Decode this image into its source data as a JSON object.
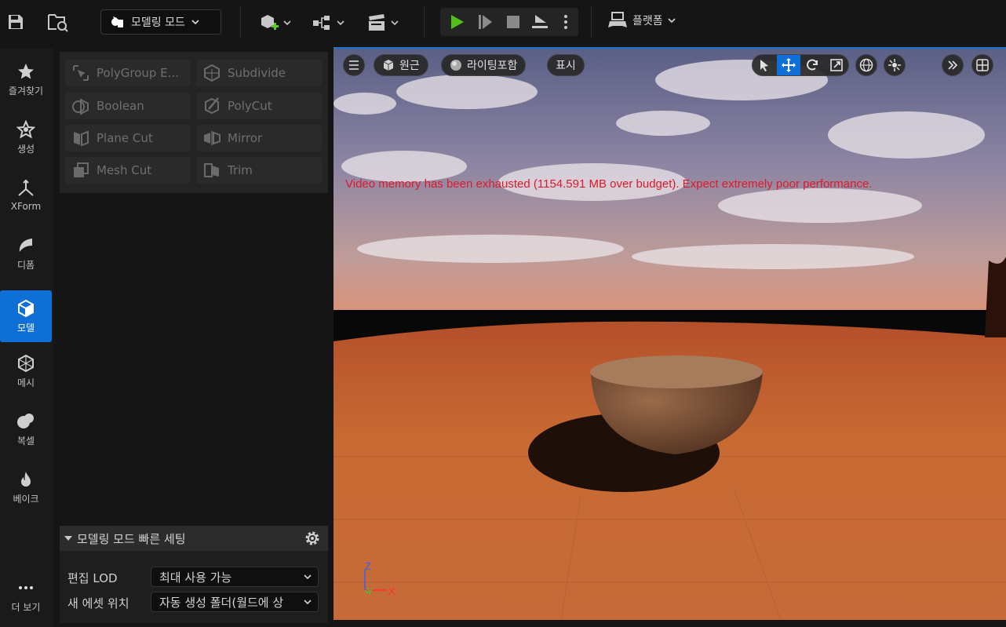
{
  "toolbar": {
    "save_icon": "save-icon",
    "browse_icon": "content-browser-icon",
    "mode_label": "모델링 모드",
    "add_actor_icon": "add-actor-icon",
    "blueprint_icon": "blueprint-icon",
    "cinematics_icon": "clapperboard-icon",
    "play_icon": "play-icon",
    "play_color": "#4fc11a",
    "skip_icon": "skip-forward-icon",
    "stop_icon": "stop-icon",
    "eject_icon": "eject-icon",
    "more_icon": "kebab-icon",
    "platform_label": "플랫폼"
  },
  "rail": {
    "items": [
      {
        "label": "즐겨찾기",
        "icon": "star-icon"
      },
      {
        "label": "생성",
        "icon": "create-icon"
      },
      {
        "label": "XForm",
        "icon": "xform-icon"
      },
      {
        "label": "디폼",
        "icon": "deform-icon"
      },
      {
        "label": "모델",
        "icon": "model-icon",
        "active": true
      },
      {
        "label": "메시",
        "icon": "mesh-icon"
      },
      {
        "label": "복셀",
        "icon": "voxel-icon"
      },
      {
        "label": "베이크",
        "icon": "bake-icon"
      }
    ],
    "more_label": "더 보기",
    "more_icon": "ellipsis-icon",
    "active_color": "#0e70d6"
  },
  "tools": [
    {
      "label": "PolyGroup E...",
      "icon": "polygroup-edit-icon"
    },
    {
      "label": "Subdivide",
      "icon": "subdivide-icon"
    },
    {
      "label": "Boolean",
      "icon": "boolean-icon"
    },
    {
      "label": "PolyCut",
      "icon": "polycut-icon"
    },
    {
      "label": "Plane Cut",
      "icon": "plane-cut-icon"
    },
    {
      "label": "Mirror",
      "icon": "mirror-icon"
    },
    {
      "label": "Mesh Cut",
      "icon": "mesh-cut-icon"
    },
    {
      "label": "Trim",
      "icon": "trim-icon"
    }
  ],
  "quick_settings": {
    "title": "모델링 모드 빠른 세팅",
    "gear_icon": "gear-icon",
    "rows": [
      {
        "label": "편집 LOD",
        "value": "최대 사용 가능"
      },
      {
        "label": "새 에셋 위치",
        "value": "자동 생성 폴더(월드에 상"
      }
    ]
  },
  "viewport": {
    "menu_icon": "hamburger-icon",
    "perspective_label": "원근",
    "lighting_label": "라이팅포함",
    "show_label": "표시",
    "transform_tools": [
      "select-icon",
      "translate-icon",
      "rotate-icon",
      "scale-icon"
    ],
    "active_transform": "translate-icon",
    "world_icon": "globe-icon",
    "snap_icon": "surface-snap-icon",
    "expand_icon": "chevrons-right-icon",
    "layout_icon": "layout-grid-icon",
    "warning_text": "Video memory has been exhausted (1154.591 MB over budget). Expect extremely poor performance.",
    "warning_color": "#e0182a",
    "axis": {
      "z": "Z",
      "y": "Y",
      "x": "X"
    }
  }
}
